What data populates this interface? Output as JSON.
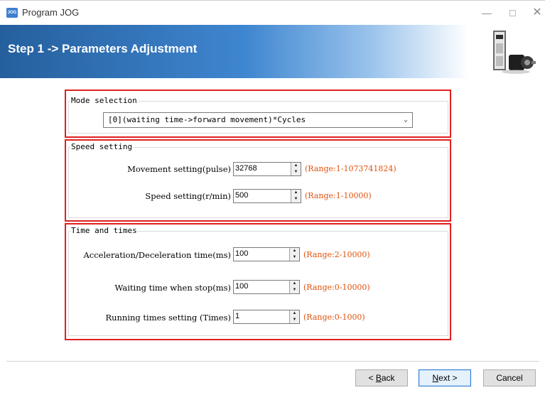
{
  "window": {
    "title": "Program JOG",
    "app_icon_text": "JOG",
    "controls": {
      "minimize": "—",
      "close": "✕"
    }
  },
  "banner": {
    "title": "Step 1 -> Parameters Adjustment",
    "image_icon": "servo-drive-and-motor"
  },
  "mode_group": {
    "legend": "Mode selection",
    "selected": "[0](waiting time->forward movement)*Cycles"
  },
  "speed_group": {
    "legend": "Speed setting",
    "fields": [
      {
        "label": "Movement setting(pulse)",
        "value": "32768",
        "range": "(Range:1-1073741824)"
      },
      {
        "label": "Speed setting(r/min)",
        "value": "500",
        "range": "(Range:1-10000)"
      }
    ]
  },
  "time_group": {
    "legend": "Time and times",
    "fields": [
      {
        "label": "Acceleration/Deceleration time(ms)",
        "value": "100",
        "range": "(Range:2-10000)"
      },
      {
        "label": "Waiting time when stop(ms)",
        "value": "100",
        "range": "(Range:0-10000)"
      },
      {
        "label": "Running times setting (Times)",
        "value": "1",
        "range": "(Range:0-1000)"
      }
    ]
  },
  "buttons": {
    "back_prefix": "< ",
    "back_key": "B",
    "back_rest": "ack",
    "next_key": "N",
    "next_rest": "ext >",
    "cancel": "Cancel"
  },
  "colors": {
    "highlight": "#e02020",
    "range_text": "#e0520d",
    "banner_start": "#255f9d"
  }
}
